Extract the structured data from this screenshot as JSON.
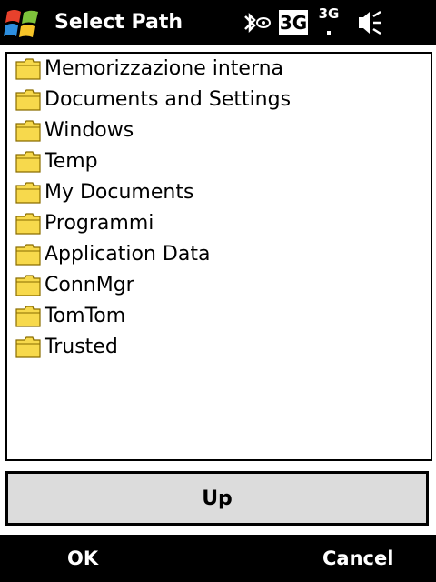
{
  "window": {
    "title": "Select Path",
    "status_icons": [
      "bluetooth-icon",
      "3g-icon",
      "3g-small-icon",
      "speaker-muted-icon"
    ],
    "network_label": "3G",
    "network_label_small": "3G"
  },
  "folders": [
    {
      "label": "Memorizzazione interna",
      "icon": "folder-icon"
    },
    {
      "label": "Documents and Settings",
      "icon": "folder-icon"
    },
    {
      "label": "Windows",
      "icon": "folder-icon"
    },
    {
      "label": "Temp",
      "icon": "folder-icon"
    },
    {
      "label": "My Documents",
      "icon": "folder-icon"
    },
    {
      "label": "Programmi",
      "icon": "folder-icon"
    },
    {
      "label": "Application Data",
      "icon": "folder-icon"
    },
    {
      "label": "ConnMgr",
      "icon": "folder-icon"
    },
    {
      "label": "TomTom",
      "icon": "folder-icon"
    },
    {
      "label": "Trusted",
      "icon": "folder-icon"
    }
  ],
  "up_button": {
    "label": "Up"
  },
  "softkeys": {
    "left": "OK",
    "right": "Cancel"
  },
  "colors": {
    "bar_background": "#000000",
    "bar_text": "#ffffff",
    "button_background": "#dcdcdc",
    "folder_fill": "#f7d94c",
    "folder_outline": "#8a6d00"
  }
}
